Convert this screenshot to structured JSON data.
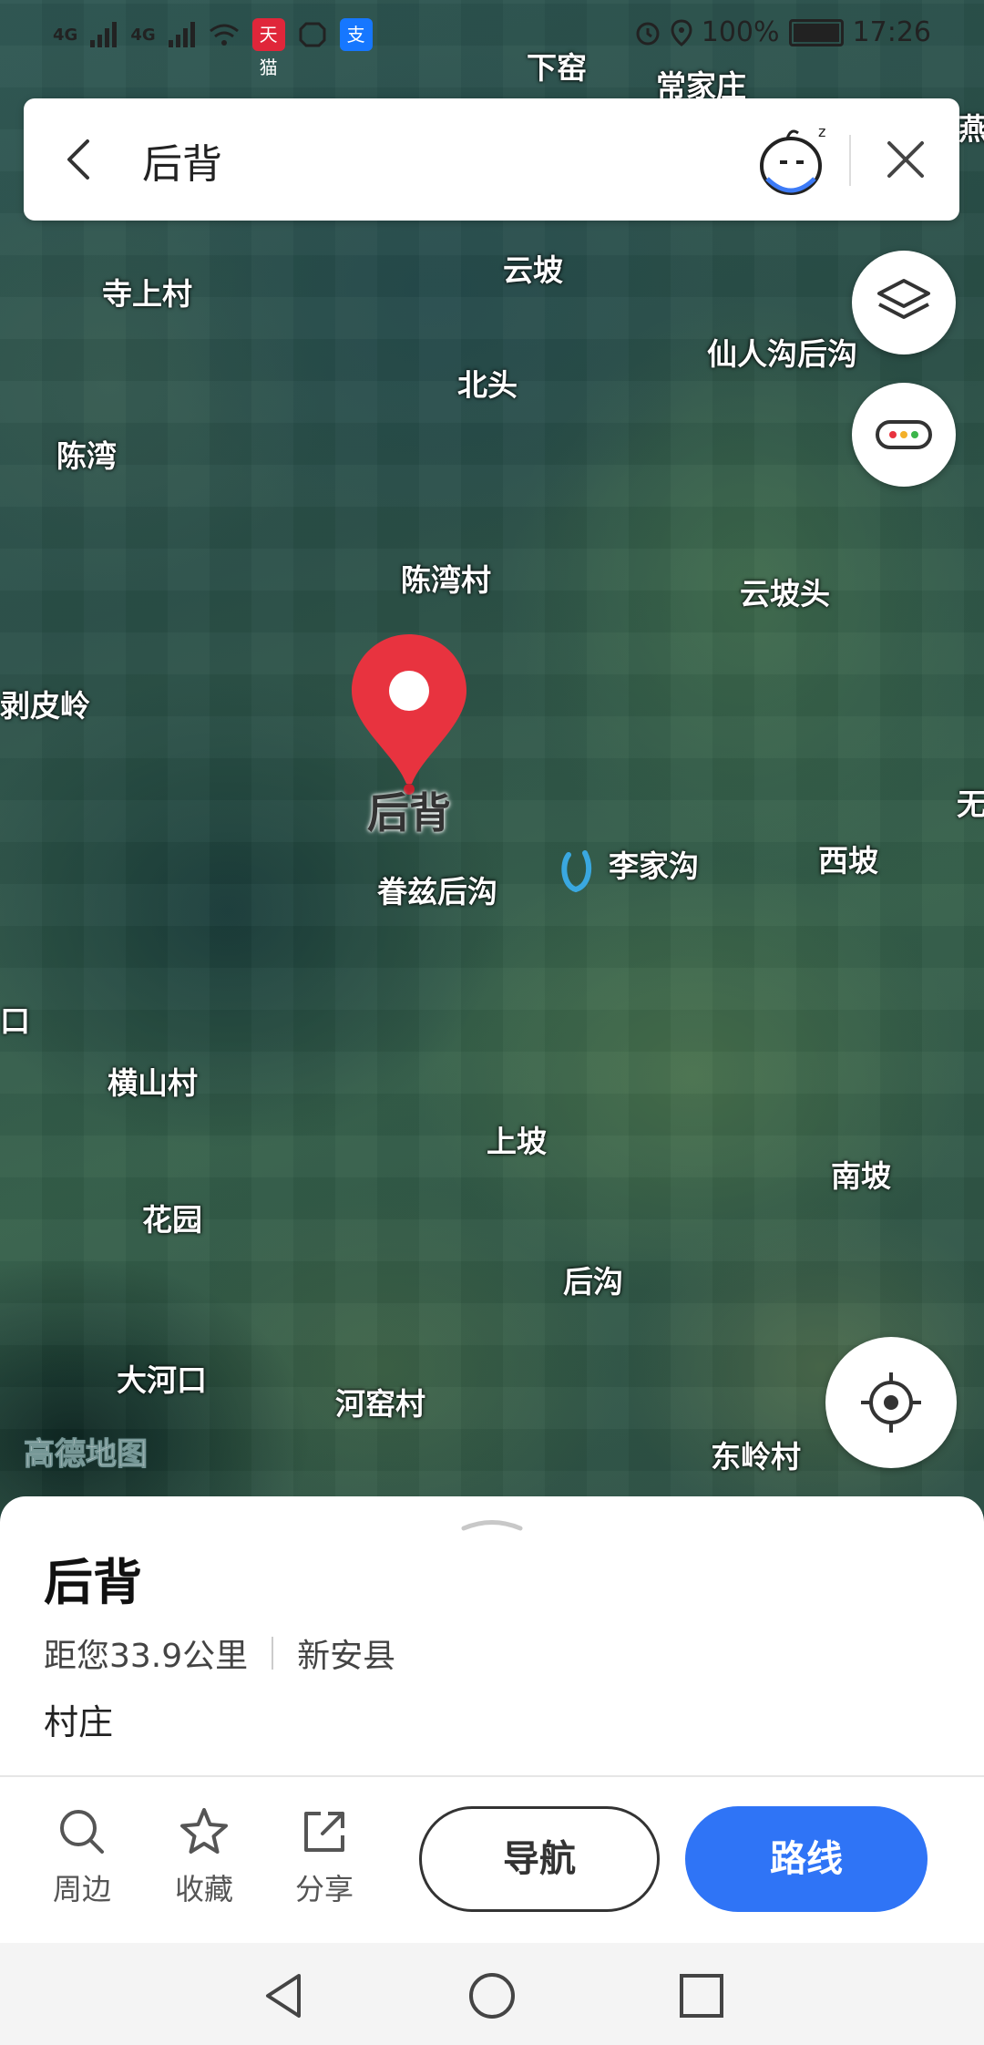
{
  "status_bar": {
    "signal_1": "4G",
    "signal_2": "4G",
    "battery": "100%",
    "time": "17:26",
    "app_badge": "天猫",
    "alipay_icon": "支"
  },
  "search": {
    "query": "后背"
  },
  "map": {
    "places": [
      "下窑",
      "常家庄",
      "燕",
      "云坡",
      "寺上村",
      "仙人沟后沟",
      "北头",
      "陈湾",
      "陈湾村",
      "云坡头",
      "剥皮岭",
      "后背",
      "李家沟",
      "西坡",
      "眷兹后沟",
      "无",
      "口",
      "横山村",
      "上坡",
      "南坡",
      "花园",
      "后沟",
      "大河口",
      "河窑村",
      "东岭村"
    ],
    "watermark": "高德地图"
  },
  "poi": {
    "title": "后背",
    "distance": "距您33.9公里",
    "county": "新安县",
    "category": "村庄"
  },
  "actions": {
    "nearby": "周边",
    "favorite": "收藏",
    "share": "分享",
    "navigate": "导航",
    "route": "路线"
  },
  "colors": {
    "marker": "#e8333f",
    "primary": "#2f74f6"
  }
}
